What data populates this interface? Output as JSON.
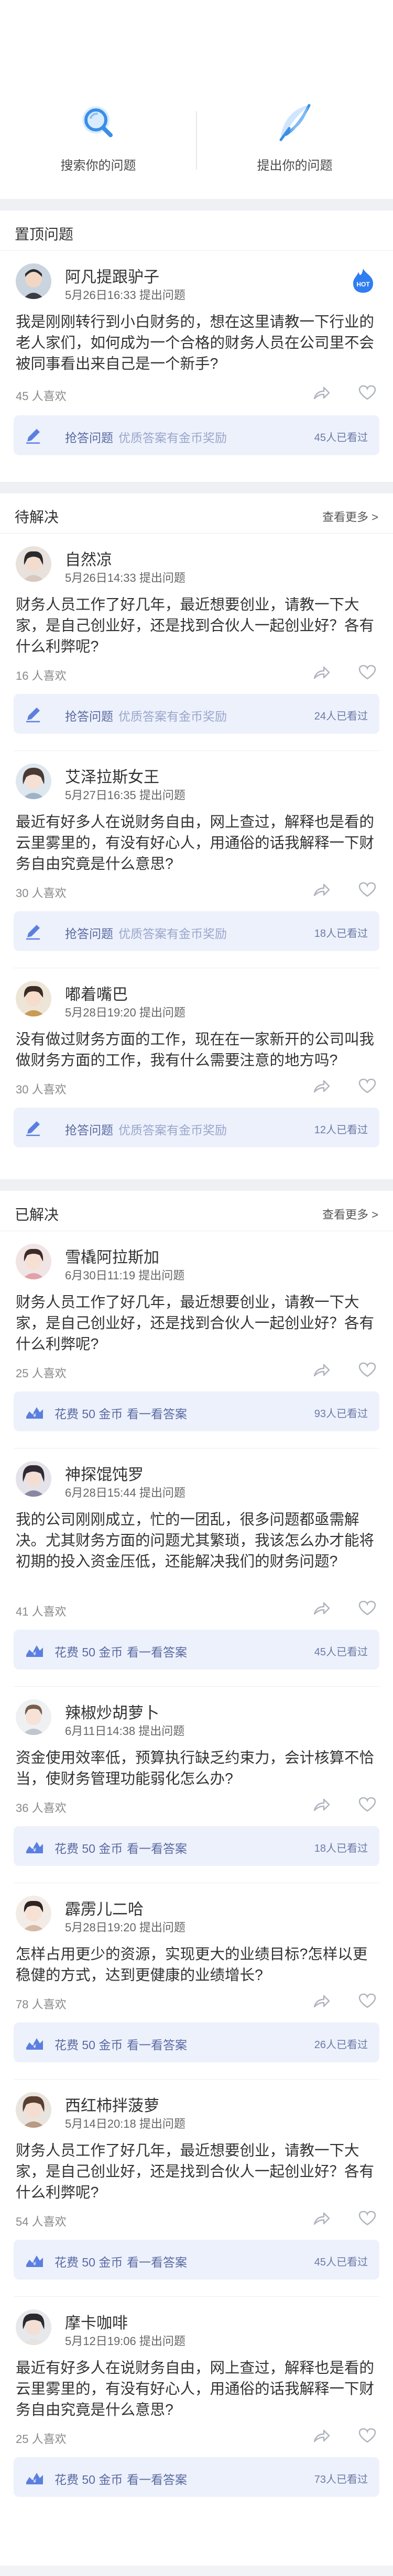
{
  "top": {
    "search_label": "搜索你的问题",
    "ask_label": "提出你的问题"
  },
  "colors": {
    "accent": "#3a8fe6",
    "bar_bg": "#edf1fb",
    "hot": "#2f7df0"
  },
  "pinned": {
    "title": "置顶问题",
    "question": {
      "name": "阿凡提跟驴子",
      "time": "5月26日16:33  提出问题",
      "text": "我是刚刚转行到小白财务的，想在这里请教一下行业的老人家们，如何成为一个合格的财务人员在公司里不会被同事看出来自己是一个新手?",
      "likes": "45 人喜欢",
      "grab": "抢答问题",
      "hint": "优质答案有金币奖励",
      "count": "45人已看过",
      "badge": "HOT"
    }
  },
  "pending": {
    "title": "待解决",
    "more": "查看更多 >",
    "items": [
      {
        "name": "自然凉",
        "time": "5月26日14:33  提出问题",
        "text": "财务人员工作了好几年，最近想要创业，请教一下大家，是自己创业好，还是找到合伙人一起创业好？各有什么利弊呢?",
        "likes": "16 人喜欢",
        "grab": "抢答问题",
        "hint": "优质答案有金币奖励",
        "count": "24人已看过"
      },
      {
        "name": "艾泽拉斯女王",
        "time": "5月27日16:35  提出问题",
        "text": "最近有好多人在说财务自由，网上查过，解释也是看的云里雾里的，有没有好心人，用通俗的话我解释一下财务自由究竟是什么意思?",
        "likes": "30 人喜欢",
        "grab": "抢答问题",
        "hint": "优质答案有金币奖励",
        "count": "18人已看过"
      },
      {
        "name": "嘟着嘴巴",
        "time": "5月28日19:20  提出问题",
        "text": "没有做过财务方面的工作，现在在一家新开的公司叫我做财务方面的工作，我有什么需要注意的地方吗?",
        "likes": "30 人喜欢",
        "grab": "抢答问题",
        "hint": "优质答案有金币奖励",
        "count": "12人已看过"
      }
    ]
  },
  "solved": {
    "title": "已解决",
    "more": "查看更多 >",
    "items": [
      {
        "name": "雪橇阿拉斯加",
        "time": "6月30日11:19  提出问题",
        "text": "财务人员工作了好几年，最近想要创业，请教一下大家，是自己创业好，还是找到合伙人一起创业好？各有什么利弊呢?",
        "likes": "25 人喜欢",
        "cost": "花费 50 金币",
        "see": "看一看答案",
        "count": "93人已看过"
      },
      {
        "name": "神探馄饨罗",
        "time": "6月28日15:44  提出问题",
        "text": "我的公司刚刚成立，忙的一团乱，很多问题都亟需解决。尤其财务方面的问题尤其繁琐，我该怎么办才能将初期的投入资金压低，还能解决我们的财务问题?",
        "likes": "41 人喜欢",
        "cost": "花费 50 金币",
        "see": "看一看答案",
        "count": "45人已看过"
      },
      {
        "name": "辣椒炒胡萝卜",
        "time": "6月11日14:38  提出问题",
        "text": "资金使用效率低，预算执行缺乏约束力，会计核算不恰当，使财务管理功能弱化怎么办?",
        "likes": "36 人喜欢",
        "cost": "花费 50 金币",
        "see": "看一看答案",
        "count": "18人已看过"
      },
      {
        "name": "霹雳儿二哈",
        "time": "5月28日19:20  提出问题",
        "text": "怎样占用更少的资源，实现更大的业绩目标?怎样以更稳健的方式，达到更健康的业绩增长?",
        "likes": "78 人喜欢",
        "cost": "花费 50 金币",
        "see": "看一看答案",
        "count": "26人已看过"
      },
      {
        "name": "西红柿拌菠萝",
        "time": "5月14日20:18  提出问题",
        "text": "财务人员工作了好几年，最近想要创业，请教一下大家，是自己创业好，还是找到合伙人一起创业好？各有什么利弊呢?",
        "likes": "54 人喜欢",
        "cost": "花费 50 金币",
        "see": "看一看答案",
        "count": "45人已看过"
      },
      {
        "name": "摩卡咖啡",
        "time": "5月12日19:06  提出问题",
        "text": "最近有好多人在说财务自由，网上查过，解释也是看的云里雾里的，有没有好心人，用通俗的话我解释一下财务自由究竟是什么意思?",
        "likes": "25 人喜欢",
        "cost": "花费 50 金币",
        "see": "看一看答案",
        "count": "73人已看过"
      }
    ]
  }
}
